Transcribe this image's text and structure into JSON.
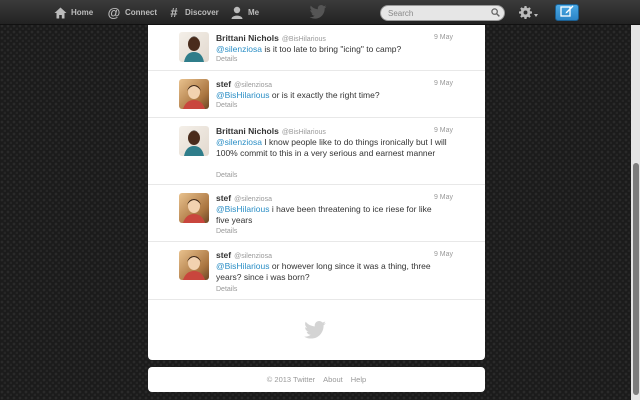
{
  "nav": {
    "home": "Home",
    "connect": "Connect",
    "discover": "Discover",
    "me": "Me"
  },
  "search": {
    "placeholder": "Search"
  },
  "colors": {
    "accent": "#2a8ec5",
    "compose": "#3a98d8"
  },
  "tweets": [
    {
      "name": "Brittani Nichols",
      "handle": "@BisHilarious",
      "time": "9 May",
      "mention": "@silenziosa",
      "text": " is it too late to bring \"icing\" to camp?",
      "details": "Details"
    },
    {
      "name": "stef",
      "handle": "@silenziosa",
      "time": "9 May",
      "mention": "@BisHilarious",
      "text": " or is it exactly the right time?",
      "details": "Details"
    },
    {
      "name": "Brittani Nichols",
      "handle": "@BisHilarious",
      "time": "9 May",
      "mention": "@silenziosa",
      "text": " I know people like to do things ironically but I will 100% commit to this in a very serious and earnest manner",
      "details": "Details"
    },
    {
      "name": "stef",
      "handle": "@silenziosa",
      "time": "9 May",
      "mention": "@BisHilarious",
      "text": " i have been threatening to ice riese for like five years",
      "details": "Details"
    },
    {
      "name": "stef",
      "handle": "@silenziosa",
      "time": "9 May",
      "mention": "@BisHilarious",
      "text": " or however long since it was a thing, three years? since i was born?",
      "details": "Details"
    }
  ],
  "footer": {
    "copyright": "© 2013 Twitter",
    "about": "About",
    "help": "Help"
  }
}
